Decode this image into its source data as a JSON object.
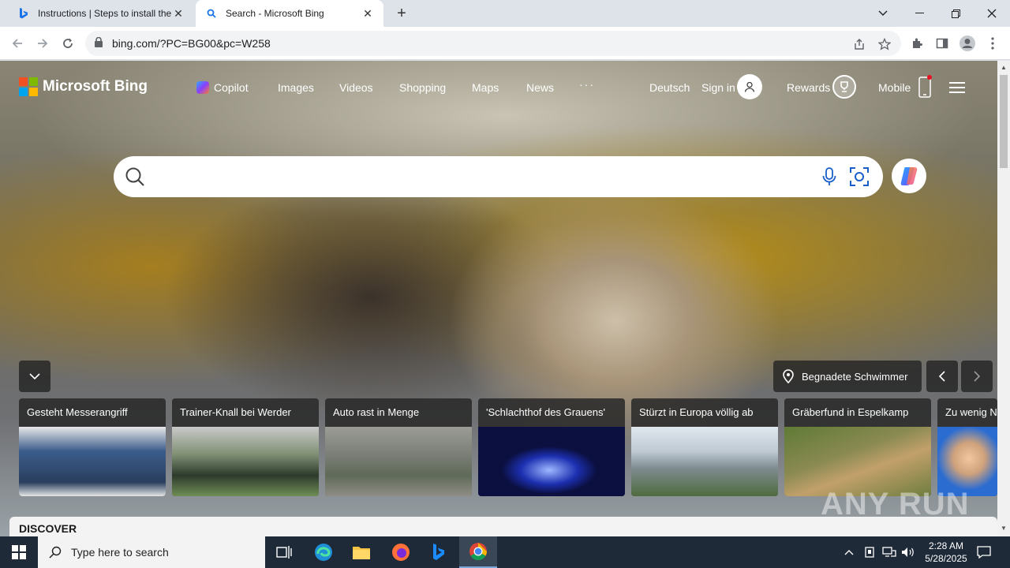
{
  "browser": {
    "tabs": [
      {
        "title": "Instructions | Steps to install the",
        "active": false
      },
      {
        "title": "Search - Microsoft Bing",
        "active": true
      }
    ],
    "url": "bing.com/?PC=BG00&pc=W258"
  },
  "bing": {
    "logo_text": "Microsoft Bing",
    "nav": [
      "Copilot",
      "Images",
      "Videos",
      "Shopping",
      "Maps",
      "News",
      "···"
    ],
    "language": "Deutsch",
    "sign_in": "Sign in",
    "rewards": "Rewards",
    "mobile": "Mobile",
    "search_placeholder": "",
    "image_caption": "Begnadete Schwimmer",
    "news_cards": [
      {
        "title": "Gesteht Messerangriff",
        "color": "#3b5c8a"
      },
      {
        "title": "Trainer-Knall bei Werder",
        "color": "#5d7c4e"
      },
      {
        "title": "Auto rast in Menge",
        "color": "#7c7f78"
      },
      {
        "title": "'Schlachthof des Grauens'",
        "color": "#1c2fb0"
      },
      {
        "title": "Stürzt in Europa völlig ab",
        "color": "#8fa0aa"
      },
      {
        "title": "Gräberfund in Espelkamp",
        "color": "#6e7d3e"
      },
      {
        "title": "Zu wenig N",
        "color": "#cfa27c"
      }
    ],
    "discover": "DISCOVER",
    "watermark": "ANY RUN"
  },
  "taskbar": {
    "search_placeholder": "Type here to search",
    "time": "2:28 AM",
    "date": "5/28/2025"
  }
}
